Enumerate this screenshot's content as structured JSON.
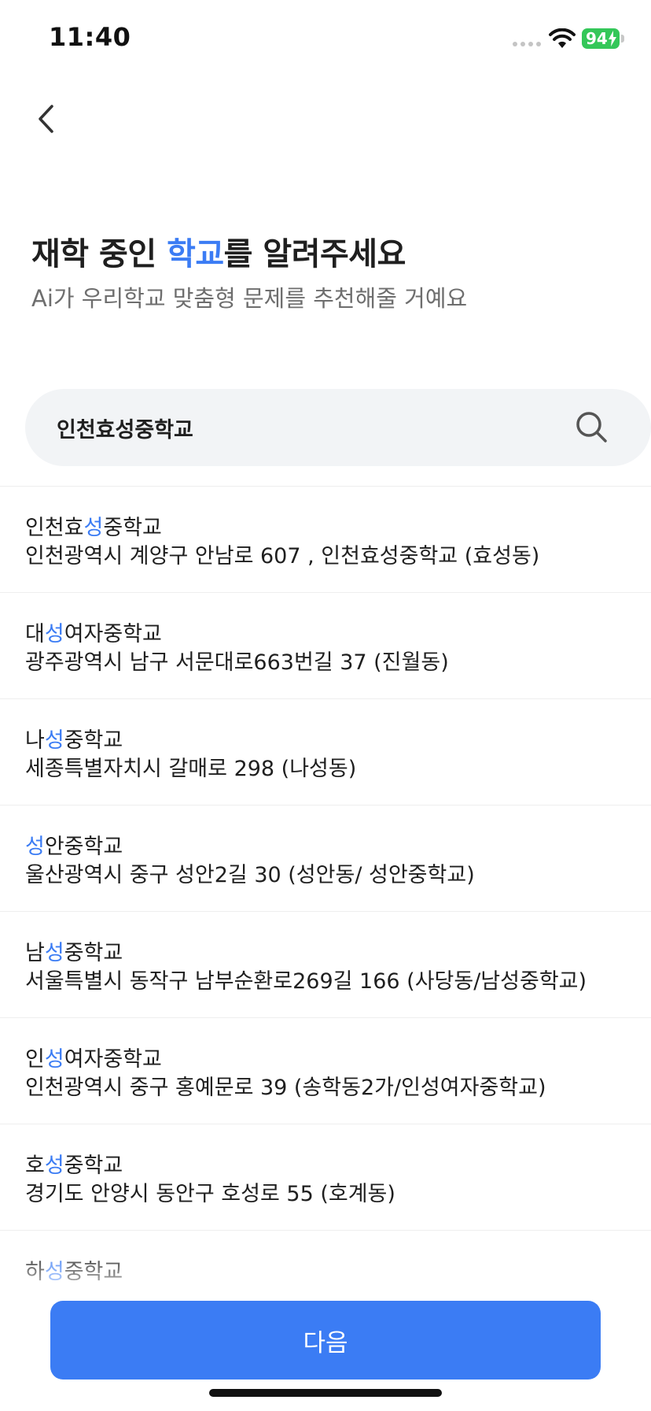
{
  "status_bar": {
    "time": "11:40",
    "battery": "94"
  },
  "header": {
    "title_before": "재학 중인 ",
    "title_accent": "학교",
    "title_after": "를 알려주세요",
    "subtitle": "Ai가 우리학교 맞춤형 문제를 추천해줄 거예요"
  },
  "search": {
    "value": "인천효성중학교"
  },
  "results": [
    {
      "pre": "인천효",
      "hl": "성",
      "post": "중학교",
      "address": "인천광역시 계양구 안남로 607 , 인천효성중학교 (효성동)"
    },
    {
      "pre": "대",
      "hl": "성",
      "post": "여자중학교",
      "address": "광주광역시 남구 서문대로663번길 37 (진월동)"
    },
    {
      "pre": "나",
      "hl": "성",
      "post": "중학교",
      "address": "세종특별자치시  갈매로 298 (나성동)"
    },
    {
      "pre": "",
      "hl": "성",
      "post": "안중학교",
      "address": "울산광역시 중구 성안2길 30 (성안동/ 성안중학교)"
    },
    {
      "pre": "남",
      "hl": "성",
      "post": "중학교",
      "address": "서울특별시 동작구 남부순환로269길 166 (사당동/남성중학교)"
    },
    {
      "pre": "인",
      "hl": "성",
      "post": "여자중학교",
      "address": "인천광역시 중구 홍예문로 39 (송학동2가/인성여자중학교)"
    },
    {
      "pre": "호",
      "hl": "성",
      "post": "중학교",
      "address": "경기도 안양시 동안구 호성로 55 (호계동)"
    },
    {
      "pre": "하",
      "hl": "성",
      "post": "중학교",
      "address": ""
    }
  ],
  "next_button": {
    "label": "다음"
  },
  "colors": {
    "accent": "#3b7cf4",
    "battery": "#34c759"
  }
}
